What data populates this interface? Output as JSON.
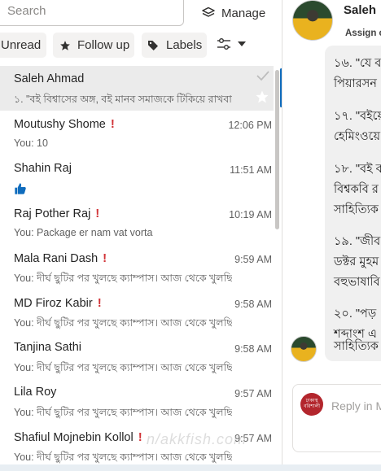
{
  "search": {
    "placeholder": "Search"
  },
  "toolbar": {
    "manage_label": "Manage"
  },
  "filters": {
    "unread": "Unread",
    "follow_up": "Follow up",
    "labels": "Labels"
  },
  "conversations": [
    {
      "name": "Saleh Ahmad",
      "preview": "১. \"বই বিশ্বাসের অঙ্গ, বই মানব সমাজকে টিকিয়ে রাখবা...",
      "time": "",
      "flag": false,
      "selected": true
    },
    {
      "name": "Moutushy Shome",
      "preview": "You: 10",
      "time": "12:06 PM",
      "flag": true
    },
    {
      "name": "Shahin Raj",
      "preview": "",
      "time": "11:51 AM",
      "flag": false,
      "thumb": true
    },
    {
      "name": "Raj Pother Raj",
      "preview": "You: Package er nam vat vorta",
      "time": "10:19 AM",
      "flag": true
    },
    {
      "name": "Mala Rani Dash",
      "preview": "You: দীর্ঘ ছুটির পর খুলছে ক্যাম্পাস। আজ থেকে খুলছি...",
      "time": "9:59 AM",
      "flag": true
    },
    {
      "name": "MD Firoz Kabir",
      "preview": "You: দীর্ঘ ছুটির পর খুলছে ক্যাম্পাস। আজ থেকে খুলছি...",
      "time": "9:58 AM",
      "flag": true
    },
    {
      "name": "Tanjina Sathi",
      "preview": "You: দীর্ঘ ছুটির পর খুলছে ক্যাম্পাস। আজ থেকে খুলছি...",
      "time": "9:58 AM",
      "flag": false
    },
    {
      "name": "Lila Roy",
      "preview": "You: দীর্ঘ ছুটির পর খুলছে ক্যাম্পাস। আজ থেকে খুলছি...",
      "time": "9:57 AM",
      "flag": false
    },
    {
      "name": "Shafiul Mojnebin Kollol",
      "preview": "You: দীর্ঘ ছুটির পর খুলছে ক্যাম্পাস। আজ থেকে খুলছি...",
      "time": "9:57 AM",
      "flag": true
    }
  ],
  "watermark": "n/akkfish.com",
  "chat": {
    "contact_name": "Saleh",
    "assign_label": "Assign c",
    "lines": [
      "১৬. \"যে ব",
      "পিয়ারসন",
      "১৭. \"বইয়ে",
      "হেমিংওয়ে",
      "১৮. \"বই ব",
      "বিশ্বকবি র",
      "সাহিত্যিক",
      "১৯. \"জীব",
      "ডক্টর মুহম",
      "বহুভাষাবি",
      "২০. \"পড়",
      "শব্দাংশ এ",
      "সাহিত্যিক"
    ],
    "reply_placeholder": "Reply in M",
    "reply_logo_text": "ঢাকাস্থ বরিশালী"
  },
  "colors": {
    "accent": "#0f6cbd",
    "flag": "#d13438",
    "selected_row": "#ebebeb",
    "pill_bg": "#f3f2f1"
  }
}
